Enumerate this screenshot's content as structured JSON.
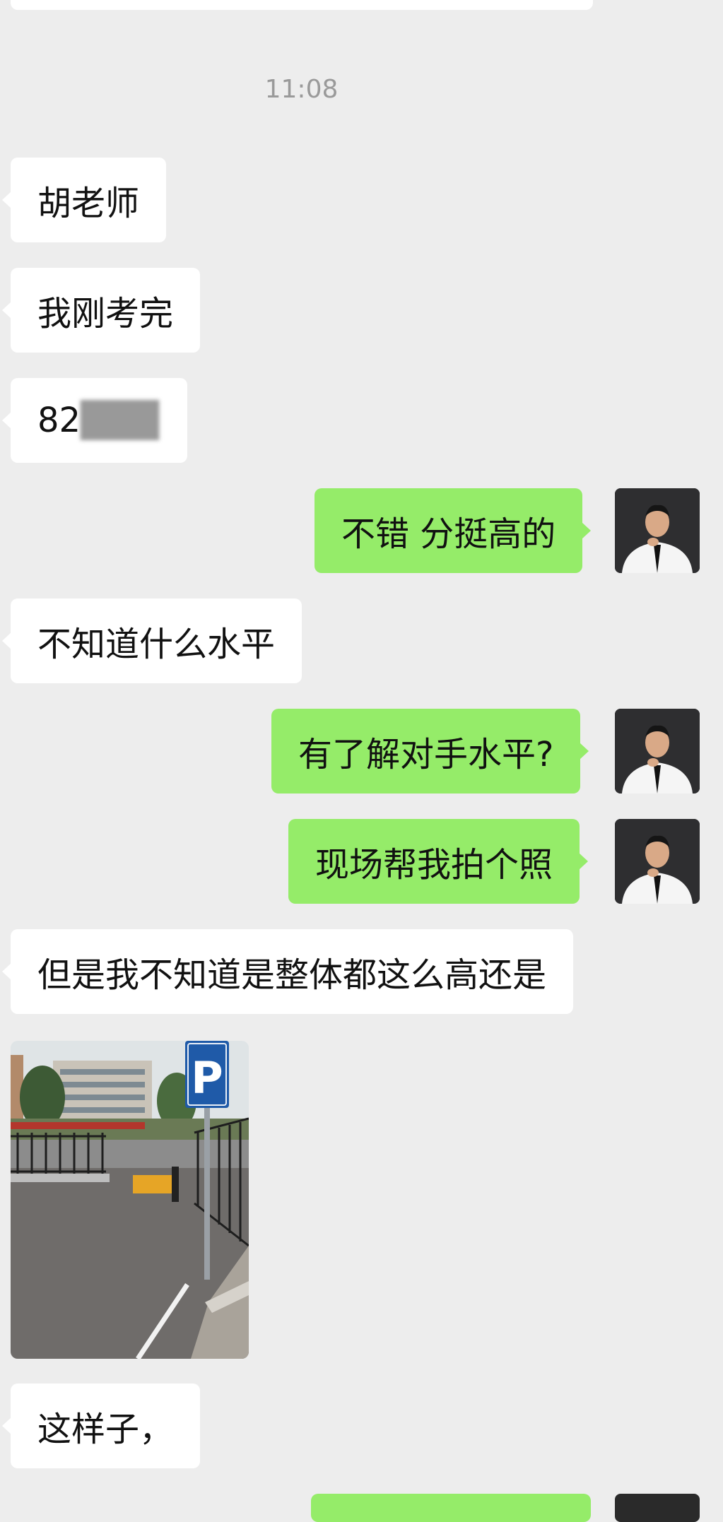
{
  "chat": {
    "timestamp": "11:08",
    "messages": [
      {
        "side": "in",
        "text": "胡老师"
      },
      {
        "side": "in",
        "text": "我刚考完"
      },
      {
        "side": "in",
        "text_visible": "82",
        "text_blurred": "███"
      },
      {
        "side": "out",
        "text": "不错 分挺高的"
      },
      {
        "side": "in",
        "text": "不知道什么水平"
      },
      {
        "side": "out",
        "text": "有了解对手水平?"
      },
      {
        "side": "out",
        "text": "现场帮我拍个照"
      },
      {
        "side": "in",
        "text": "但是我不知道是整体都这么高还是"
      },
      {
        "side": "in",
        "type": "image",
        "content": "parking-lot-photo"
      },
      {
        "side": "in",
        "text": "这样子，"
      }
    ]
  },
  "photo": {
    "sign_letter": "P"
  },
  "colors": {
    "background": "#ededed",
    "incoming_bubble": "#ffffff",
    "outgoing_bubble": "#95ec69"
  }
}
